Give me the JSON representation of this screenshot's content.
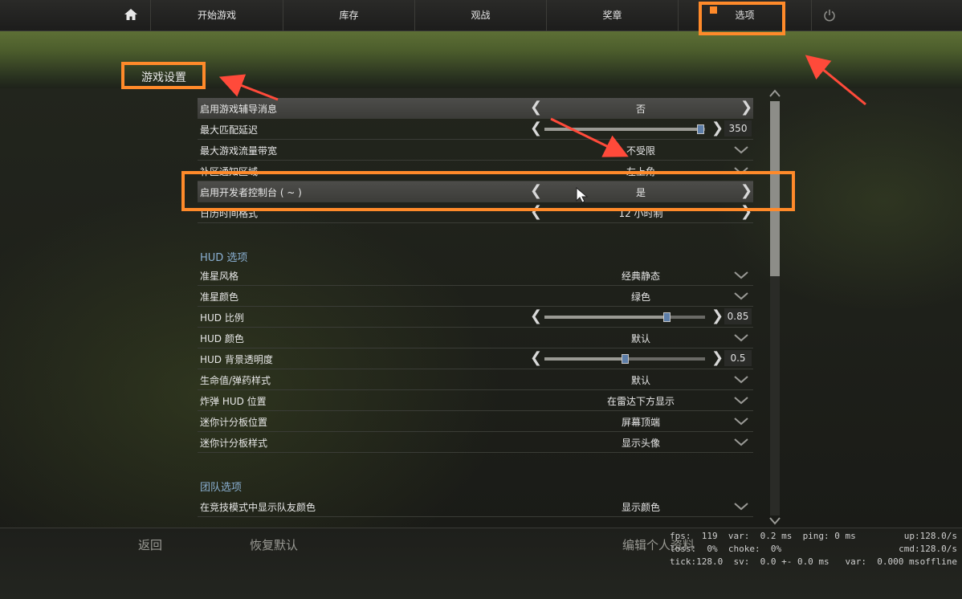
{
  "nav": {
    "home_icon": "home-icon",
    "items": [
      "开始游戏",
      "库存",
      "观战",
      "奖章",
      "选项"
    ],
    "power_icon": "power-icon"
  },
  "section_title": "游戏设置",
  "rows": [
    {
      "label": "启用游戏辅导消息",
      "value": "否"
    },
    {
      "label": "最大匹配延迟",
      "value": "350",
      "slider_level": 0.98
    },
    {
      "label": "最大游戏流量带宽",
      "value": "不受限"
    },
    {
      "label": "补区通知区域",
      "value": "左上角"
    },
    {
      "label": "启用开发者控制台 ( ~ )",
      "value": "是"
    },
    {
      "label": "日历时间格式",
      "value": "12 小时制"
    }
  ],
  "hud_group": {
    "title": "HUD 选项",
    "rows": [
      {
        "label": "准星风格",
        "value": "经典静态"
      },
      {
        "label": "准星颜色",
        "value": "绿色"
      },
      {
        "label": "HUD 比例",
        "value": "0.85",
        "slider_level": 0.76
      },
      {
        "label": "HUD 颜色",
        "value": "默认"
      },
      {
        "label": "HUD 背景透明度",
        "value": "0.5",
        "slider_level": 0.5
      },
      {
        "label": "生命值/弹药样式",
        "value": "默认"
      },
      {
        "label": "炸弹 HUD 位置",
        "value": "在雷达下方显示"
      },
      {
        "label": "迷你计分板位置",
        "value": "屏幕顶端"
      },
      {
        "label": "迷你计分板样式",
        "value": "显示头像"
      }
    ]
  },
  "team_group": {
    "title": "团队选项",
    "rows": [
      {
        "label": "在竞技模式中显示队友颜色",
        "value": "显示颜色"
      }
    ]
  },
  "bottom": {
    "back_label": "返回",
    "reset_label": "恢复默认",
    "profile_label": "编辑个人资料"
  },
  "netgraph": {
    "line1": "fps:  119  var:  0.2 ms  ping: 0 ms",
    "line2": "loss:  0%  choke:  0%",
    "line3": "tick:128.0  sv:  0.0 +- 0.0 ms   var:  0.000 ms",
    "right1": "up:128.0/s",
    "right2": "cmd:128.0/s",
    "right3": "offline"
  },
  "colors": {
    "annotation": "#ff8a2a",
    "arrow": "#ff4a3a",
    "group_title": "#8ab0d2"
  }
}
